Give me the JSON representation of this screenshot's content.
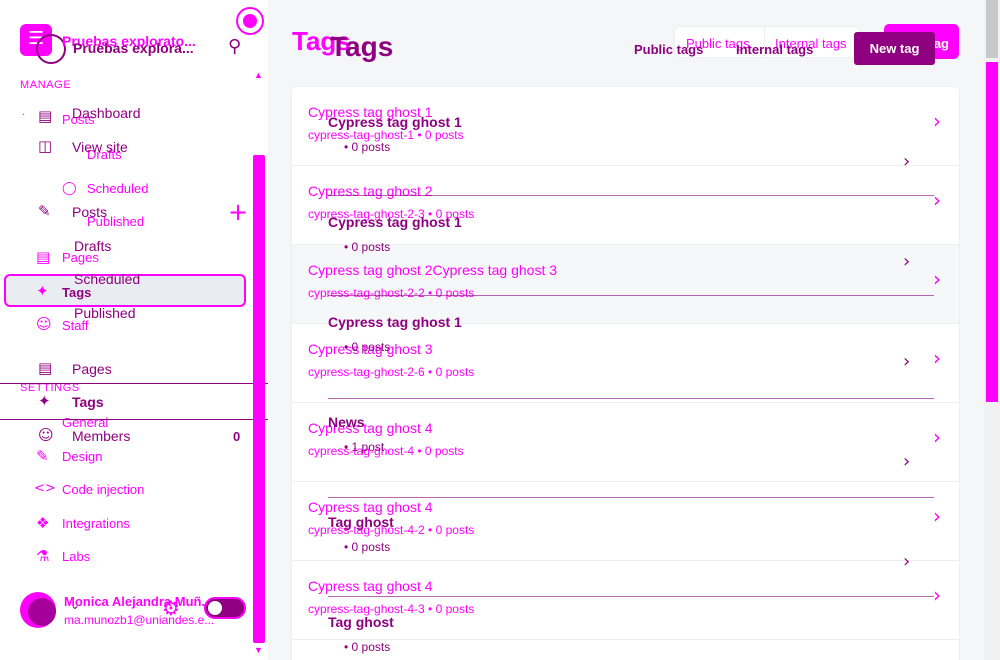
{
  "sidebar": {
    "site_title_a": "Pruebas explorato...",
    "site_title_b": "Pruebas explora...",
    "manage_label": "MANAGE",
    "settings_label": "SETTINGS",
    "pink_nav": {
      "posts": "Posts",
      "drafts": "Drafts",
      "scheduled": "Scheduled",
      "published": "Published",
      "pages": "Pages",
      "tags": "Tags",
      "staff": "Staff",
      "general": "General",
      "design": "Design",
      "code_injection": "Code injection",
      "integrations": "Integrations",
      "labs": "Labs"
    },
    "dark_nav": {
      "dashboard": "Dashboard",
      "view_site": "View site",
      "posts": "Posts",
      "drafts": "Drafts",
      "scheduled": "Scheduled",
      "published": "Published",
      "pages": "Pages",
      "tags": "Tags",
      "members": "Members",
      "members_count": "0"
    },
    "user": {
      "name": "Monica Alejandra Muñ...",
      "email": "ma.munozb1@uniandes.e..."
    }
  },
  "header": {
    "title_pink": "Tags",
    "title_dark": "Tags",
    "public_tags_pink": "Public tags",
    "internal_tags_pink": "Internal tags",
    "public_tags_dark": "Public tags",
    "internal_tags_dark": "Internal tags",
    "new_tag_pink": "New tag",
    "new_tag_dark": "New tag"
  },
  "tags_list": [
    {
      "title": "Cypress tag ghost 1",
      "sub": "cypress-tag-ghost-1 • 0 posts"
    },
    {
      "title": "Cypress tag ghost 2",
      "sub": "cypress-tag-ghost-2-3 • 0 posts"
    },
    {
      "title": "Cypress tag ghost 2Cypress tag ghost 3",
      "sub": "cypress-tag-ghost-2-2 • 0 posts"
    },
    {
      "title": "Cypress tag ghost 3",
      "sub": "cypress-tag-ghost-2-6 • 0 posts"
    },
    {
      "title": "Cypress tag ghost 4",
      "sub": "cypress-tag-ghost-4 • 0 posts"
    },
    {
      "title": "Cypress tag ghost 4",
      "sub": "cypress-tag-ghost-4-2 • 0 posts"
    },
    {
      "title": "Cypress tag ghost 4",
      "sub": "cypress-tag-ghost-4-3 • 0 posts"
    }
  ],
  "dark_list": [
    {
      "title": "Cypress tag ghost 1",
      "sub": "• 0 posts"
    },
    {
      "title": "Cypress tag ghost 1",
      "sub": "• 0 posts"
    },
    {
      "title": "Cypress tag ghost 1",
      "sub": "• 0 posts"
    },
    {
      "title": "News",
      "sub": "• 1 post"
    },
    {
      "title": "Tag ghost",
      "sub": "• 0 posts"
    },
    {
      "title": "Tag ghost",
      "sub": "• 0 posts"
    }
  ],
  "colors": {
    "accent_pink": "#ff00ff",
    "accent_dark": "#8e007f"
  }
}
